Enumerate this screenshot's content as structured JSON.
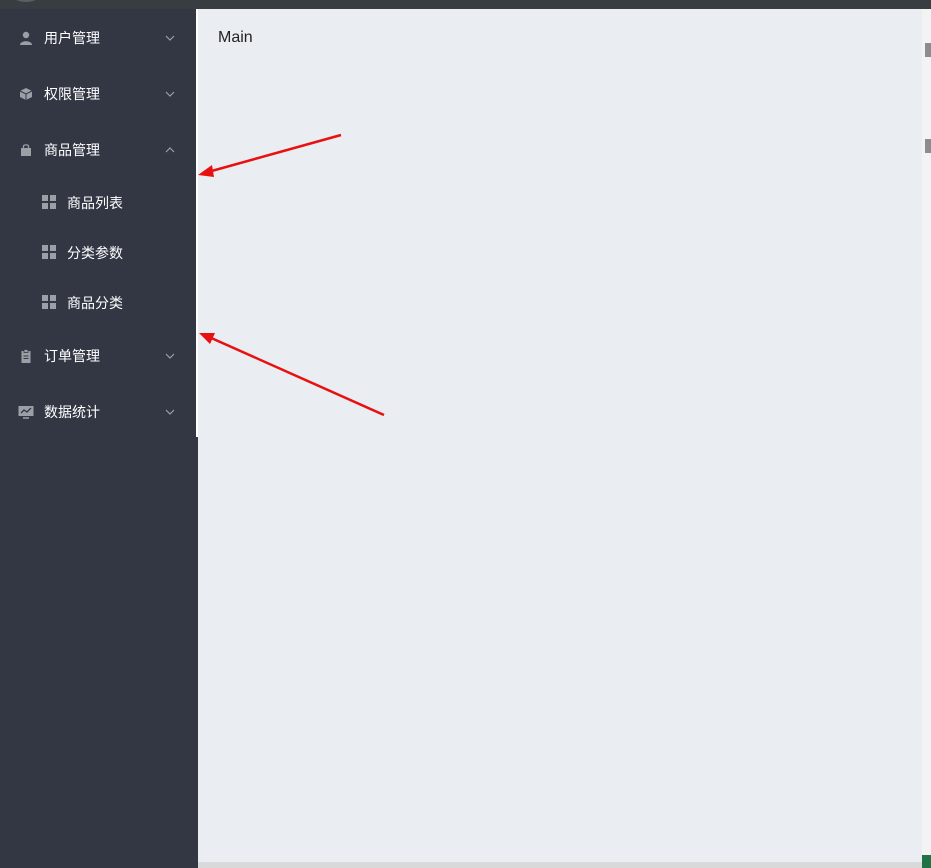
{
  "sidebar": {
    "menus": [
      {
        "label": "用户管理",
        "icon": "user-icon",
        "expanded": false
      },
      {
        "label": "权限管理",
        "icon": "cube-icon",
        "expanded": false
      },
      {
        "label": "商品管理",
        "icon": "bag-icon",
        "expanded": true
      },
      {
        "label": "订单管理",
        "icon": "clipboard-icon",
        "expanded": false
      },
      {
        "label": "数据统计",
        "icon": "chart-icon",
        "expanded": false
      }
    ],
    "goods_submenu": [
      {
        "label": "商品列表",
        "icon": "grid-icon"
      },
      {
        "label": "分类参数",
        "icon": "grid-icon"
      },
      {
        "label": "商品分类",
        "icon": "grid-icon"
      }
    ]
  },
  "main": {
    "title": "Main"
  },
  "colors": {
    "sidebar_bg": "#333744",
    "main_bg": "#eaedf1",
    "annotation_arrow": "#e81010",
    "icon_gray": "#9aa0a6"
  }
}
